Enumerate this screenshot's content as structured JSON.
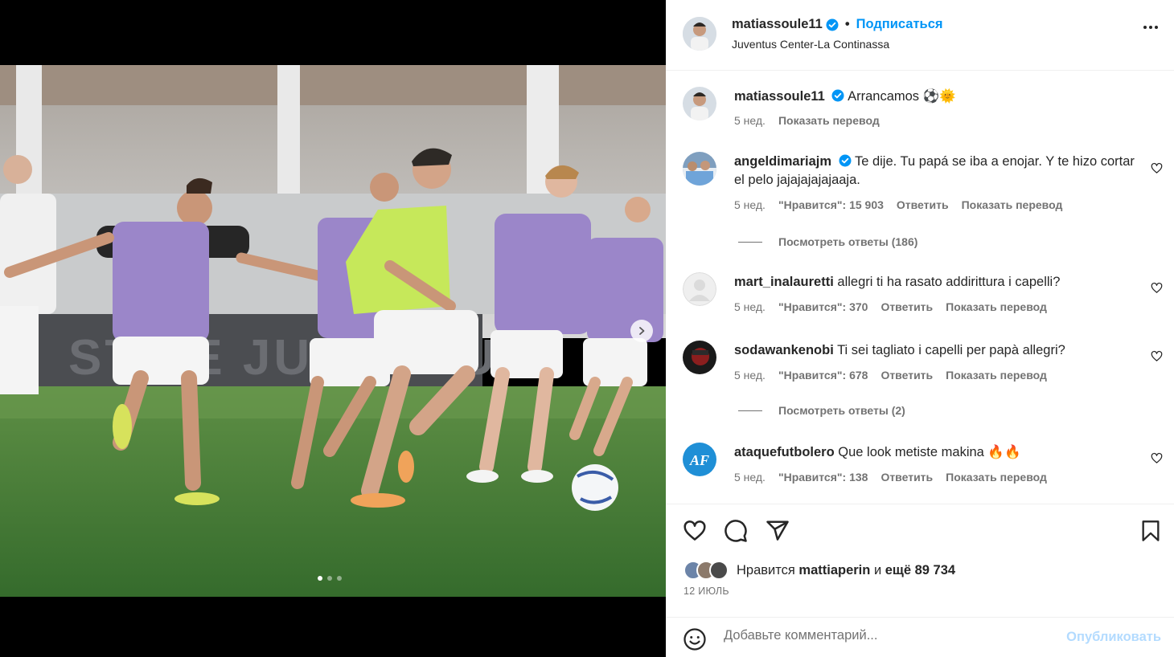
{
  "post": {
    "author": "matiassoule11",
    "follow_label": "Подписаться",
    "separator": "•",
    "location": "Juventus Center-La Continassa",
    "more_icon": "more-horizontal-icon"
  },
  "media": {
    "slide_count": 3,
    "active_slide": 1,
    "next_icon": "chevron-right-icon",
    "colors": {
      "pitch": "#3f7a34",
      "bib_purple": "#9b86c9",
      "bib_green": "#c6e85a"
    }
  },
  "caption": {
    "user": "matiassoule11",
    "text": "Arrancamos ⚽🌞",
    "time": "5 нед.",
    "translate": "Показать перевод"
  },
  "comments": [
    {
      "user": "angeldimariajm",
      "verified": true,
      "text": "Te dije. Tu papá se iba a enojar. Y te hizo cortar el pelo jajajajajajaaja.",
      "time": "5 нед.",
      "likes": "\"Нравится\": 15 903",
      "reply": "Ответить",
      "translate": "Показать перевод",
      "view_replies": "Посмотреть ответы (186)"
    },
    {
      "user": "mart_inalauretti",
      "text": "allegri ti ha rasato addirittura i capelli?",
      "time": "5 нед.",
      "likes": "\"Нравится\": 370",
      "reply": "Ответить",
      "translate": "Показать перевод"
    },
    {
      "user": "sodawankenobi",
      "text": "Ti sei tagliato i capelli per papà allegri?",
      "time": "5 нед.",
      "likes": "\"Нравится\": 678",
      "reply": "Ответить",
      "translate": "Показать перевод",
      "view_replies": "Посмотреть ответы (2)"
    },
    {
      "user": "ataquefutbolero",
      "text": "Que look metiste makina 🔥🔥",
      "time": "5 нед.",
      "likes": "\"Нравится\": 138",
      "reply": "Ответить",
      "translate": "Показать перевод"
    }
  ],
  "footer": {
    "liked_prefix": "Нравится",
    "liked_user": "mattiaperin",
    "liked_and": "и",
    "liked_more": "ещё 89 734",
    "date": "12 ИЮЛЬ",
    "comment_placeholder": "Добавьте комментарий...",
    "publish_label": "Опубликовать"
  },
  "colors": {
    "accent": "#0095f6",
    "publish_disabled": "#b3dbff",
    "muted": "#737373",
    "text": "#262626"
  }
}
